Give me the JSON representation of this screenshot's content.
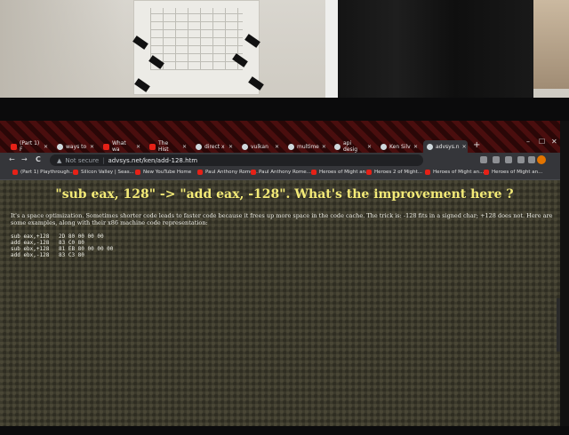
{
  "browser": {
    "tabs": [
      {
        "label": "(Part 1) F",
        "icon": "youtube-icon"
      },
      {
        "label": "ways to",
        "icon": "globe-icon"
      },
      {
        "label": "What wa",
        "icon": "youtube-icon"
      },
      {
        "label": "The Hist",
        "icon": "youtube-icon"
      },
      {
        "label": "direct x",
        "icon": "globe-icon"
      },
      {
        "label": "vulkan",
        "icon": "globe-icon"
      },
      {
        "label": "multime",
        "icon": "globe-icon"
      },
      {
        "label": "api desig",
        "icon": "globe-icon"
      },
      {
        "label": "Ken Silv",
        "icon": "globe-icon"
      },
      {
        "label": "advsys.n",
        "icon": "globe-icon",
        "active": true
      }
    ],
    "new_tab": "+",
    "controls": {
      "minimize": "–",
      "maximize": "☐",
      "close": "✕"
    },
    "nav": {
      "back": "←",
      "forward": "→",
      "reload": "C"
    },
    "address": {
      "security": "Not secure",
      "separator": "|",
      "url": "advsys.net/ken/add-128.htm"
    },
    "bookmarks": [
      "(Part 1) Playthrough...",
      "Silicon Valley | Seas...",
      "New YouTube Home",
      "Paul Anthony Rome...",
      "Paul Anthony Rome...",
      "Heroes of Might an...",
      "Heroes 2 of Might...",
      "Heroes of Might an...",
      "Heroes of Might an..."
    ]
  },
  "page": {
    "title": "\"sub eax, 128\" -> \"add eax, -128\". What's the improvement here ?",
    "paragraph": "It's a space optimization. Sometimes shorter code leads to faster code because it frees up more space in the code cache. The trick is: -128 fits in a signed char; +128 does not. Here are some examples, along with their x86 machine code representation:",
    "code_rows": [
      {
        "instruction": "sub eax,+128",
        "bytes": "2D 80 00 00 00"
      },
      {
        "instruction": "add eax,-128",
        "bytes": "83 C0 80"
      },
      {
        "instruction": "sub ebx,+128",
        "bytes": "81 EB 80 00 00 00"
      },
      {
        "instruction": "add ebx,-128",
        "bytes": "83 C3 80"
      }
    ]
  },
  "colors": {
    "title": "#f3ea77",
    "text": "#f1f1e8",
    "page_bg": "#3c3a2c",
    "tabstrip": "#4a0e0e",
    "chrome": "#35363a"
  }
}
